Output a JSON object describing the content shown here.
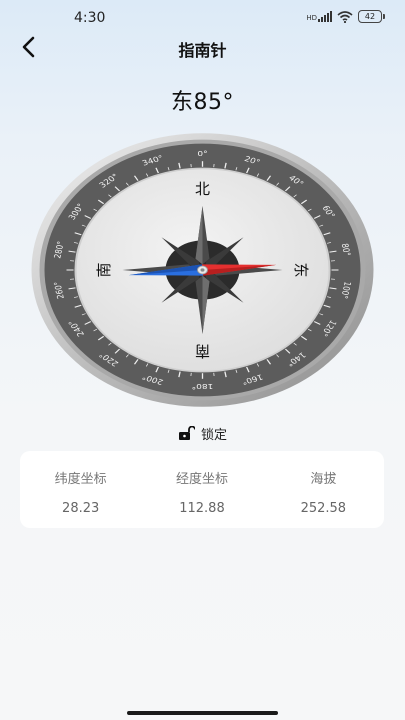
{
  "status_bar": {
    "time": "4:30",
    "signal_label": "HD",
    "battery_level": "42"
  },
  "header": {
    "title": "指南针"
  },
  "heading": {
    "direction_text": "东85°"
  },
  "compass": {
    "heading_degrees": 85,
    "cardinal_labels": {
      "north": "北",
      "east": "东",
      "south": "南",
      "west": "南"
    },
    "degree_labels": [
      "0°",
      "20°",
      "40°",
      "60°",
      "80°",
      "100°",
      "120°",
      "140°",
      "160°",
      "180°",
      "200°",
      "220°",
      "240°",
      "260°",
      "280°",
      "300°",
      "320°",
      "340°"
    ],
    "colors": {
      "needle_red": "#e53030",
      "needle_blue": "#2a6fe0",
      "bezel": "#5a5a5a",
      "face": "#e9e9e9"
    }
  },
  "lock": {
    "label": "锁定",
    "icon": "unlocked-padlock-icon"
  },
  "coordinates": {
    "latitude": {
      "label": "纬度坐标",
      "value": "28.23"
    },
    "longitude": {
      "label": "经度坐标",
      "value": "112.88"
    },
    "altitude": {
      "label": "海拔",
      "value": "252.58"
    }
  }
}
